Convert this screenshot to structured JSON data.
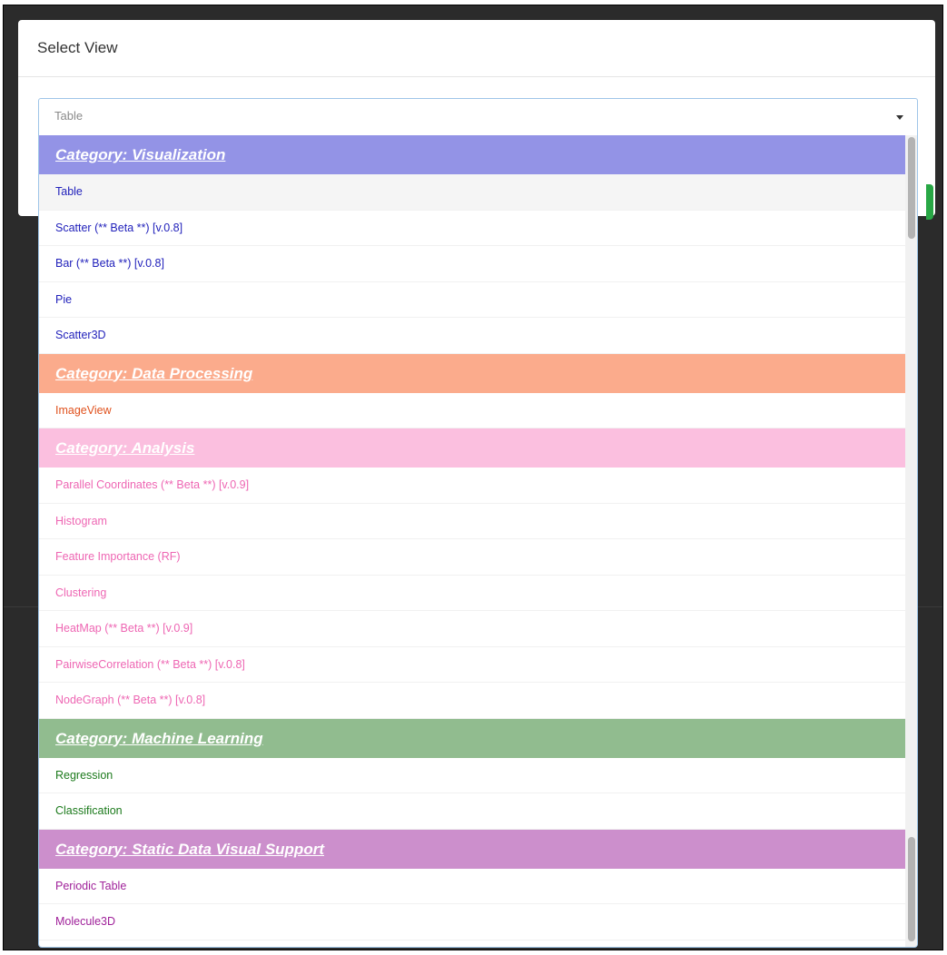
{
  "modal": {
    "title": "Select View"
  },
  "select": {
    "placeholder": "Table"
  },
  "colors": {
    "visualization_header": "#9393e6",
    "visualization_text": "#2222bb",
    "data_processing_header": "#fbab8c",
    "data_processing_text": "#e0521e",
    "analysis_header": "#fbbfdf",
    "analysis_text": "#ee66b3",
    "machine_learning_header": "#91bc8f",
    "machine_learning_text": "#1c7a1c",
    "static_data_header": "#cc8fcc",
    "static_data_text": "#a0229a"
  },
  "categories": [
    {
      "label": "Category: Visualization",
      "items": [
        "Table",
        "Scatter (** Beta **) [v.0.8]",
        "Bar (** Beta **) [v.0.8]",
        "Pie",
        "Scatter3D"
      ]
    },
    {
      "label": "Category: Data Processing",
      "items": [
        "ImageView"
      ]
    },
    {
      "label": "Category: Analysis",
      "items": [
        "Parallel Coordinates (** Beta **) [v.0.9]",
        "Histogram",
        "Feature Importance (RF)",
        "Clustering",
        "HeatMap (** Beta **) [v.0.9]",
        "PairwiseCorrelation (** Beta **) [v.0.8]",
        "NodeGraph (** Beta **) [v.0.8]"
      ]
    },
    {
      "label": "Category: Machine Learning",
      "items": [
        "Regression",
        "Classification"
      ]
    },
    {
      "label": "Category: Static Data Visual Support",
      "items": [
        "Periodic Table",
        "Molecule3D"
      ]
    }
  ]
}
